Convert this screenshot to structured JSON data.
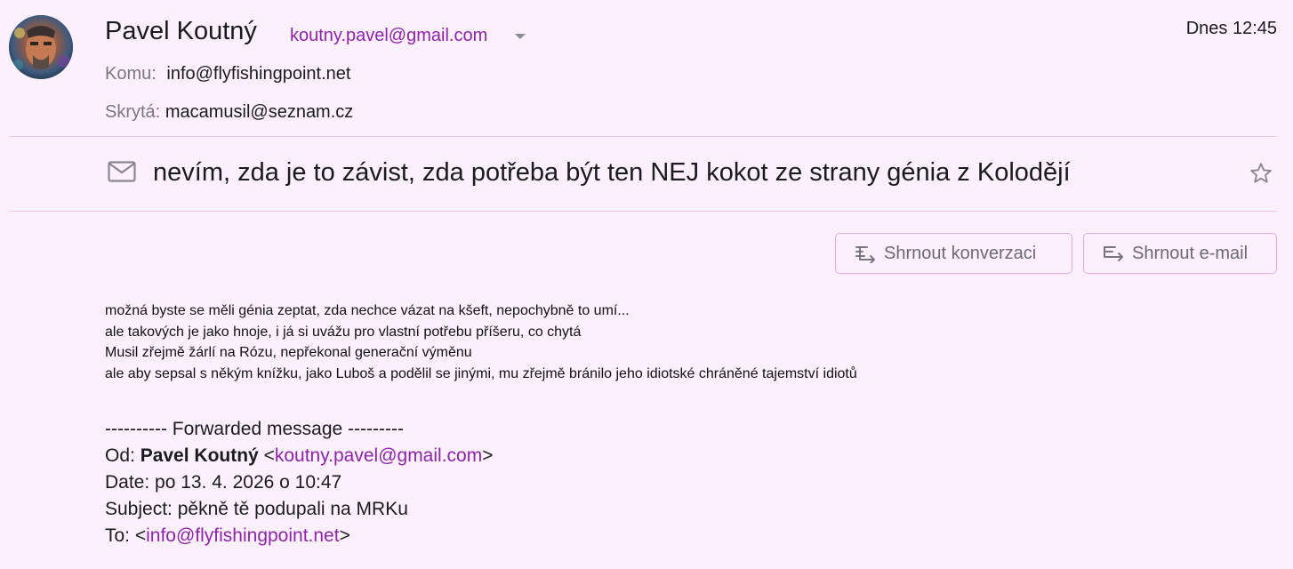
{
  "sender": {
    "name": "Pavel Koutný",
    "email": "koutny.pavel@gmail.com"
  },
  "date": "Dnes 12:45",
  "recipients": {
    "to_label": "Komu:",
    "to_value": "info@flyfishingpoint.net",
    "bcc_label": "Skrytá:",
    "bcc_value": "macamusil@seznam.cz"
  },
  "subject": "nevím, zda je to závist, zda potřeba být ten NEJ kokot ze strany génia z Kolodějí",
  "actions": {
    "summarize_conversation": "Shrnout konverzaci",
    "summarize_email": "Shrnout e-mail"
  },
  "body_lines": [
    "možná byste se měli génia zeptat, zda nechce vázat na kšeft, nepochybně to umí...",
    "ale takových je jako hnoje, i já si uvážu pro vlastní potřebu příšeru, co chytá",
    "Musil zřejmě žárlí na Rózu, nepřekonal generační výměnu",
    "ale aby sepsal s někým knížku, jako Luboš a podělil se jinými, mu zřejmě  bránilo jeho idiotské chráněné tajemství idiotů"
  ],
  "forwarded": {
    "header": "---------- Forwarded message ---------",
    "from_label": "Od: ",
    "from_name": "Pavel Koutný",
    "from_email": "koutny.pavel@gmail.com",
    "date_line": "Date: po 13. 4. 2026 o 10:47",
    "subject_line": "Subject: pěkně tě podupali na MRKu",
    "to_label": "To: ",
    "to_email": "info@flyfishingpoint.net"
  },
  "icons": {
    "avatar": "avatar-portrait",
    "subject": "mail-envelope-icon",
    "star": "star-outline-icon",
    "summarize": "summarize-lines-icon"
  },
  "colors": {
    "background": "#fdf0fd",
    "accent_link": "#8e24aa",
    "divider": "#ecc3ef",
    "button_border": "#e6a9ec"
  }
}
